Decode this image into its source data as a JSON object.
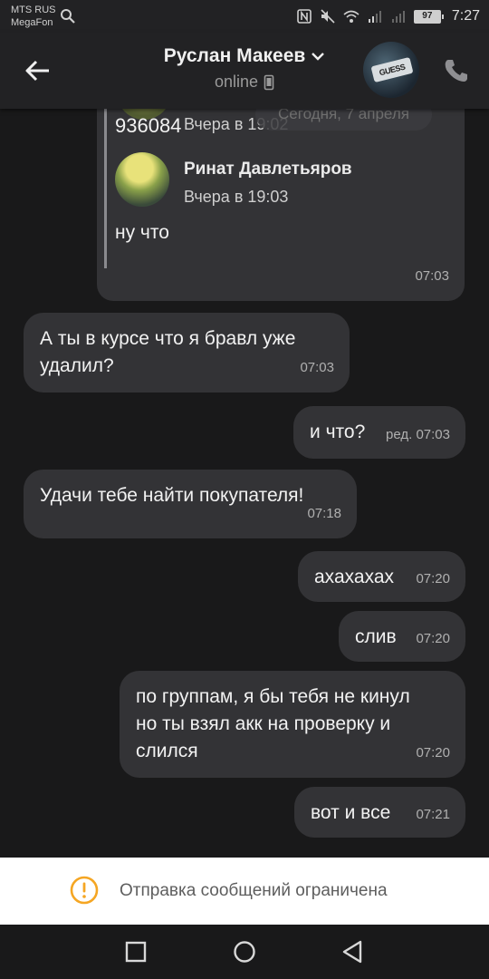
{
  "status_bar": {
    "carrier_1": "MTS RUS",
    "carrier_2": "MegaFon",
    "battery": "97",
    "time": "7:27",
    "icons": [
      "search-icon",
      "nfc-icon",
      "mute-icon",
      "wifi-icon",
      "signal-icon",
      "signal-icon",
      "battery-icon"
    ]
  },
  "header": {
    "title": "Руслан Макеев",
    "subtitle": "online",
    "icons": [
      "back-arrow-icon",
      "chevron-down-icon",
      "phone-device-icon",
      "call-icon"
    ],
    "avatar_text": "GUESS"
  },
  "messages": [
    {
      "type": "forwarded",
      "side": "out",
      "ghost_time": "Вчера в 19:02",
      "date_pill": "Сегодня, 7 апреля",
      "code": "936084",
      "fwd_name": "Ринат Давлетьяров",
      "fwd_time": "Вчера в 19:03",
      "fwd_text": "ну что",
      "time": "07:03"
    },
    {
      "side": "in",
      "text_1": "А ты в курсе что я бравл уже",
      "text_2": "удалил?",
      "time": "07:03"
    },
    {
      "side": "out",
      "text": "и что?",
      "time": "ред. 07:03"
    },
    {
      "side": "in",
      "text": "Удачи тебе найти покупателя!",
      "time": "07:18"
    },
    {
      "side": "out",
      "text": "ахахахах",
      "time": "07:20"
    },
    {
      "side": "out",
      "text": "слив",
      "time": "07:20"
    },
    {
      "side": "out",
      "text_1": "по группам, я бы тебя не кинул",
      "text_2": "но ты взял акк на проверку и",
      "text_3": "слился",
      "time": "07:20"
    },
    {
      "side": "out",
      "text": "вот и все",
      "time": "07:21"
    }
  ],
  "notice": {
    "text": "Отправка сообщений ограничена",
    "icon": "warning-icon",
    "accent": "#f5a623"
  },
  "nav": {
    "icons": [
      "recent-apps-icon",
      "home-icon",
      "back-icon"
    ]
  }
}
